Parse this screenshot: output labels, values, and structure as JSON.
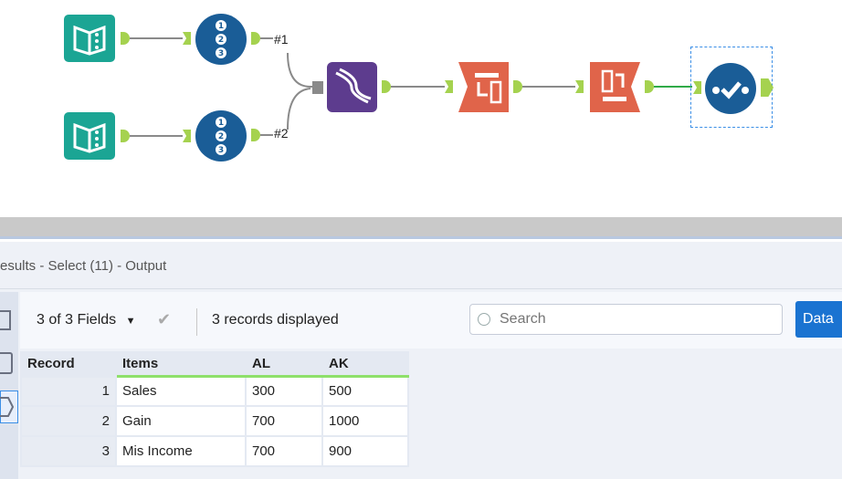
{
  "workflow": {
    "tools": [
      {
        "id": "input-1",
        "type": "input-data",
        "color": "#1ba594"
      },
      {
        "id": "input-2",
        "type": "input-data",
        "color": "#1ba594"
      },
      {
        "id": "record-id-1",
        "type": "record-id",
        "color": "#1a5d97"
      },
      {
        "id": "record-id-2",
        "type": "record-id",
        "color": "#1a5d97"
      },
      {
        "id": "join-multiple",
        "type": "join",
        "color": "#5d3c8e"
      },
      {
        "id": "transpose",
        "type": "transpose",
        "color": "#e0644a"
      },
      {
        "id": "crosstab",
        "type": "crosstab",
        "color": "#e0644a"
      },
      {
        "id": "select",
        "type": "select",
        "color": "#1a5d97",
        "selected": true
      }
    ],
    "join_labels": [
      "#1",
      "#2"
    ],
    "anchor_color": "#a5d24f",
    "active_connection_color": "#2faa48"
  },
  "results": {
    "title": "esults - Select (11) - Output",
    "fields_label": "3 of 3 Fields",
    "records_label": "3 records displayed",
    "search_placeholder": "Search",
    "data_button": "Data",
    "columns": [
      "Record",
      "Items",
      "AL",
      "AK"
    ],
    "rows": [
      [
        "1",
        "Sales",
        "300",
        "500"
      ],
      [
        "2",
        "Gain",
        "700",
        "1000"
      ],
      [
        "3",
        "Mis Income",
        "700",
        "900"
      ]
    ]
  }
}
